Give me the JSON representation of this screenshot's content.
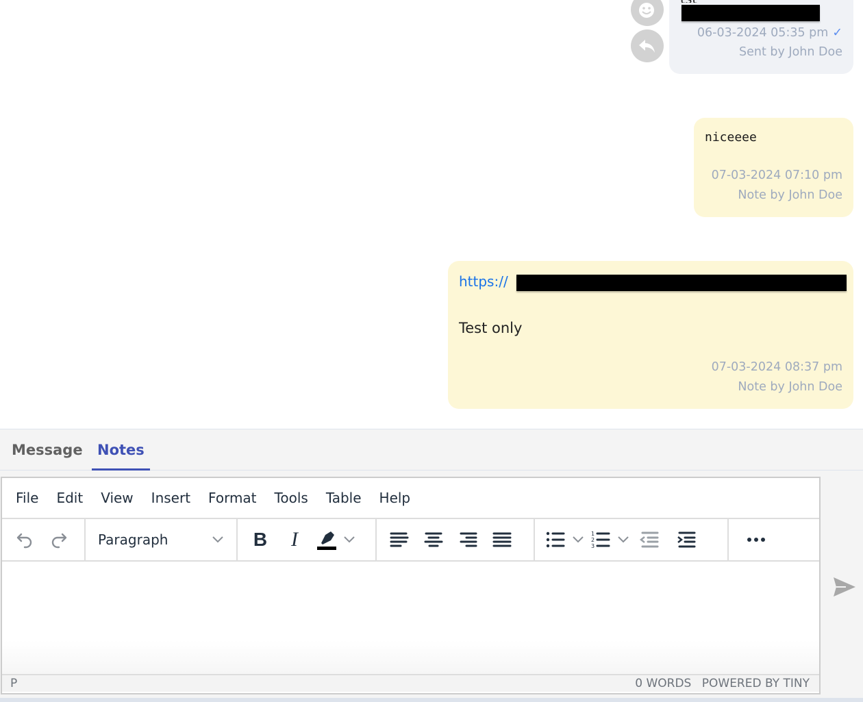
{
  "messages": [
    {
      "type": "sent",
      "text_partial": "tst",
      "redacted": true,
      "timestamp": "06-03-2024 05:35 pm",
      "status_icon": "check-icon",
      "author_line": "Sent by John Doe",
      "side_actions": [
        "emoji-add-icon",
        "reply-icon"
      ]
    },
    {
      "type": "note",
      "text": "niceeee",
      "timestamp": "07-03-2024 07:10 pm",
      "author_line": "Note by John Doe"
    },
    {
      "type": "note",
      "link_prefix": "https://",
      "link_redacted": true,
      "text": "Test only",
      "timestamp": "07-03-2024 08:37 pm",
      "author_line": "Note by John Doe"
    }
  ],
  "composer": {
    "tabs": [
      {
        "label": "Message",
        "active": false
      },
      {
        "label": "Notes",
        "active": true
      }
    ],
    "accent_color": "#3f51b5",
    "editor": {
      "menu": [
        "File",
        "Edit",
        "View",
        "Insert",
        "Format",
        "Tools",
        "Table",
        "Help"
      ],
      "block_format": "Paragraph",
      "toolbar_icons": [
        "undo-icon",
        "redo-icon",
        "bold-icon",
        "italic-icon",
        "highlight-icon",
        "align-left-icon",
        "align-center-icon",
        "align-right-icon",
        "align-justify-icon",
        "bullet-list-icon",
        "numbered-list-icon",
        "outdent-icon",
        "indent-icon",
        "more-icon"
      ],
      "content": "",
      "status_path": "P",
      "word_count": "0 WORDS",
      "branding": "POWERED BY TINY"
    },
    "send_icon": "send-icon"
  },
  "colors": {
    "sent_bubble": "#f0f2f6",
    "note_bubble": "#fdf7d6",
    "meta_text": "#9eaabe",
    "link": "#1a73e8"
  }
}
